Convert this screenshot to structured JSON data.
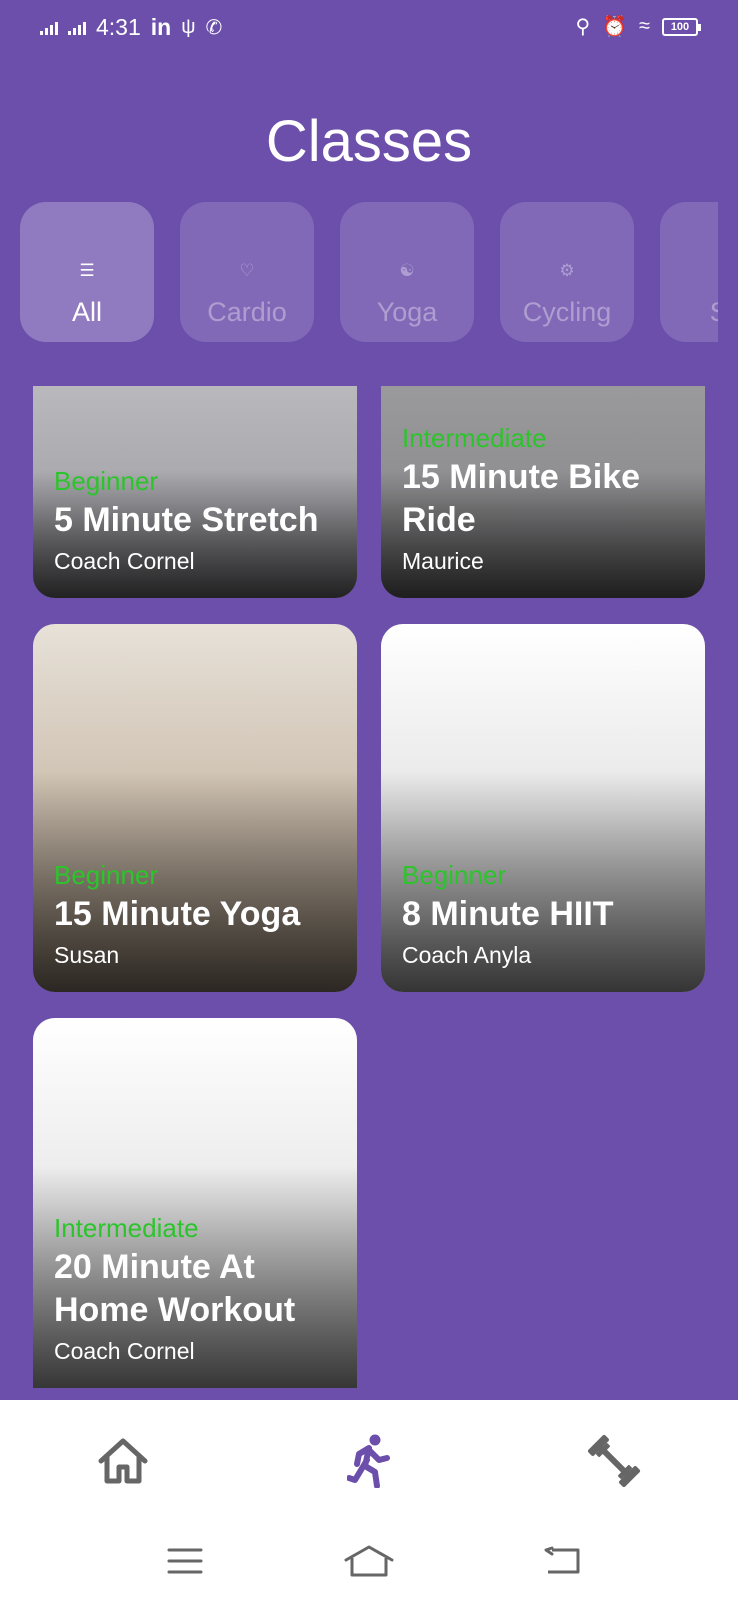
{
  "status_bar": {
    "time": "4:31",
    "linkedin": "in",
    "battery": "100"
  },
  "page": {
    "title": "Classes"
  },
  "categories": [
    {
      "label": "All",
      "icon": "list-icon",
      "active": true
    },
    {
      "label": "Cardio",
      "icon": "heart-pulse-icon",
      "active": false
    },
    {
      "label": "Yoga",
      "icon": "yoga-icon",
      "active": false
    },
    {
      "label": "Cycling",
      "icon": "cycling-icon",
      "active": false
    },
    {
      "label": "Str",
      "icon": "strength-icon",
      "active": false
    }
  ],
  "classes": [
    {
      "level": "Beginner",
      "title": "5 Minute Stretch",
      "coach": "Coach Cornel"
    },
    {
      "level": "Intermediate",
      "title": "15 Minute Bike Ride",
      "coach": "Maurice"
    },
    {
      "level": "Beginner",
      "title": "15 Minute Yoga",
      "coach": "Susan"
    },
    {
      "level": "Beginner",
      "title": "8 Minute HIIT",
      "coach": "Coach Anyla"
    },
    {
      "level": "Intermediate",
      "title": "20 Minute At Home Workout",
      "coach": "Coach Cornel"
    }
  ],
  "bottom_nav": [
    {
      "icon": "home-icon",
      "active": false
    },
    {
      "icon": "running-icon",
      "active": true
    },
    {
      "icon": "dumbbell-icon",
      "active": false
    }
  ],
  "colors": {
    "background": "#6c4fab",
    "level_text": "#2bc52b",
    "nav_active": "#6c4fab",
    "nav_inactive": "#666666"
  }
}
